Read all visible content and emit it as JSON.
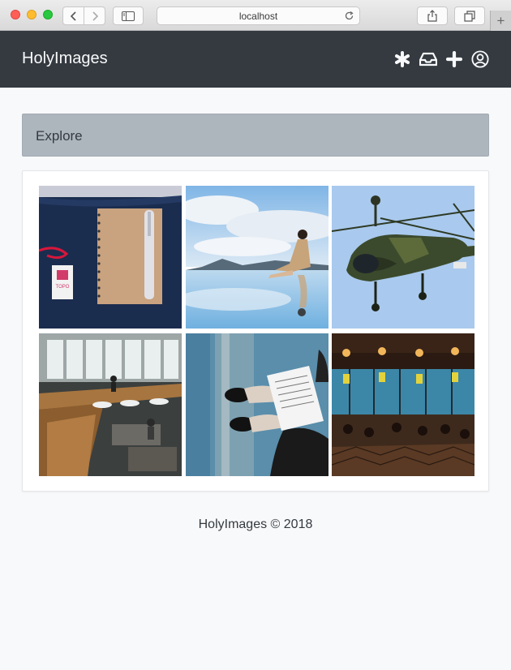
{
  "browser": {
    "url": "localhost"
  },
  "navbar": {
    "brand": "HolyImages",
    "icons": [
      "asterisk-icon",
      "inbox-icon",
      "plus-icon",
      "user-circle-icon"
    ]
  },
  "explore": {
    "title": "Explore"
  },
  "gallery": {
    "images": [
      "notebook-on-bag",
      "woman-on-mirror-lake",
      "military-helicopter",
      "office-lounge",
      "person-reading-papers",
      "restaurant-with-lamps"
    ]
  },
  "footer": {
    "text": "HolyImages © 2018"
  },
  "colors": {
    "navbar": "#343a40",
    "explore_bg": "#adb5bd",
    "page_bg": "#f8f9fa"
  }
}
